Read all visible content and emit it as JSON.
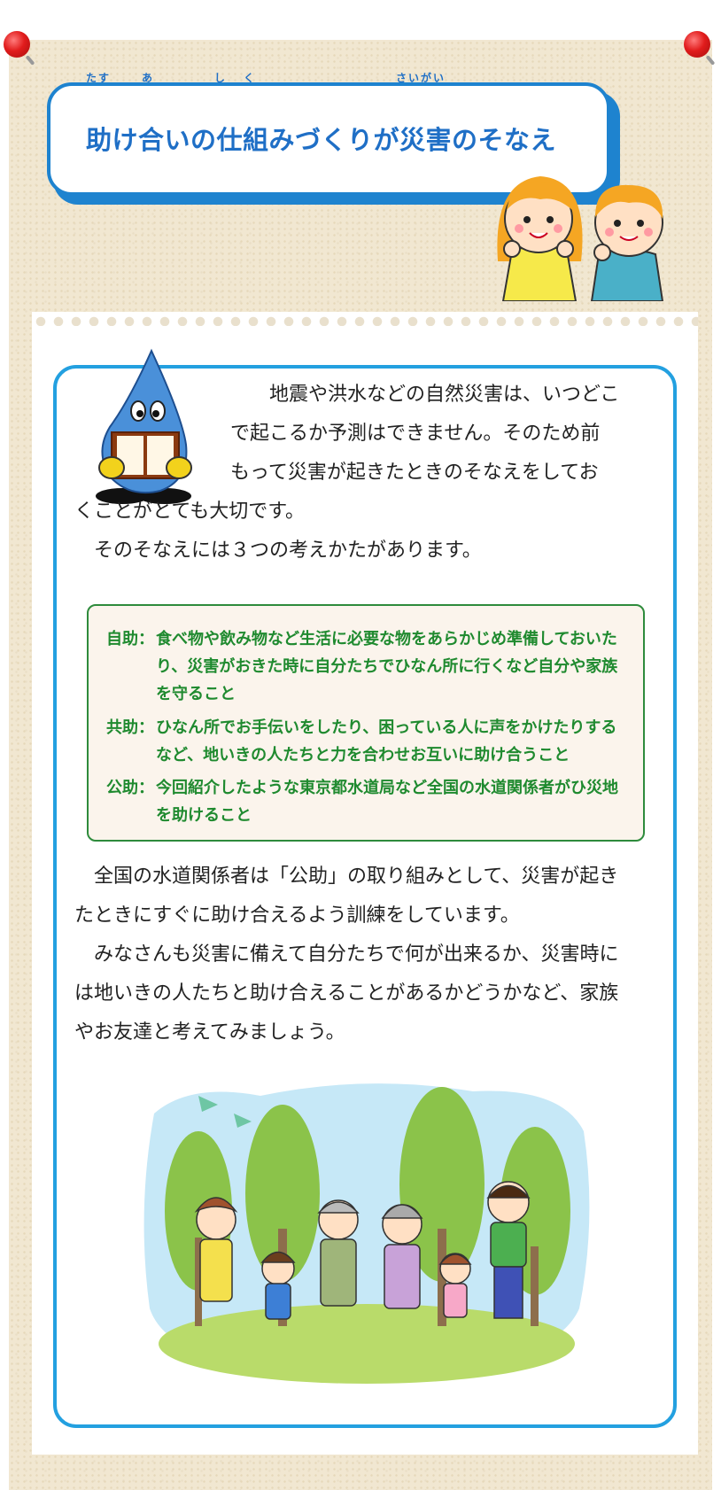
{
  "title": {
    "text": "助け合いの仕組みづくりが災害のそなえ",
    "ruby": [
      "たす",
      "あ",
      "し",
      "く",
      "さいがい"
    ]
  },
  "intro": {
    "line1": "地震や洪水などの自然災害は、いつどこ",
    "line2": "で起こるか予測はできません。そのため前",
    "line3": "もって災害が起きたときのそなえをしてお",
    "line4": "くことがとても大切です。",
    "line5": "そのそなえには３つの考えかたがあります。"
  },
  "types": [
    {
      "label": "自助：",
      "text": "食べ物や飲み物など生活に必要な物をあらかじめ準備しておいたり、災害がおきた時に自分たちでひなん所に行くなど自分や家族を守ること"
    },
    {
      "label": "共助：",
      "text": "ひなん所でお手伝いをしたり、困っている人に声をかけたりするなど、地いきの人たちと力を合わせお互いに助け合うこと"
    },
    {
      "label": "公助：",
      "text": "今回紹介したような東京都水道局など全国の水道関係者がひ災地を助けること"
    }
  ],
  "closing": {
    "p1_line1": "全国の水道関係者は「公助」の取り組みとして、災害が起き",
    "p1_line2": "たときにすぐに助け合えるよう訓練をしています。",
    "p2_line1": "みなさんも災害に備えて自分たちで何が出来るか、災害時に",
    "p2_line2": "は地いきの人たちと助け合えることがあるかどうかなど、家族",
    "p2_line3": "やお友達と考えてみましょう。"
  },
  "colors": {
    "accent_blue": "#1e83cf",
    "green": "#1f8a2f",
    "board": "#f1e7d1",
    "pin": "#e11c1c"
  },
  "icons": [
    "pushpin-icon",
    "water-drop-mascot",
    "children-illustration",
    "family-forest-illustration"
  ]
}
